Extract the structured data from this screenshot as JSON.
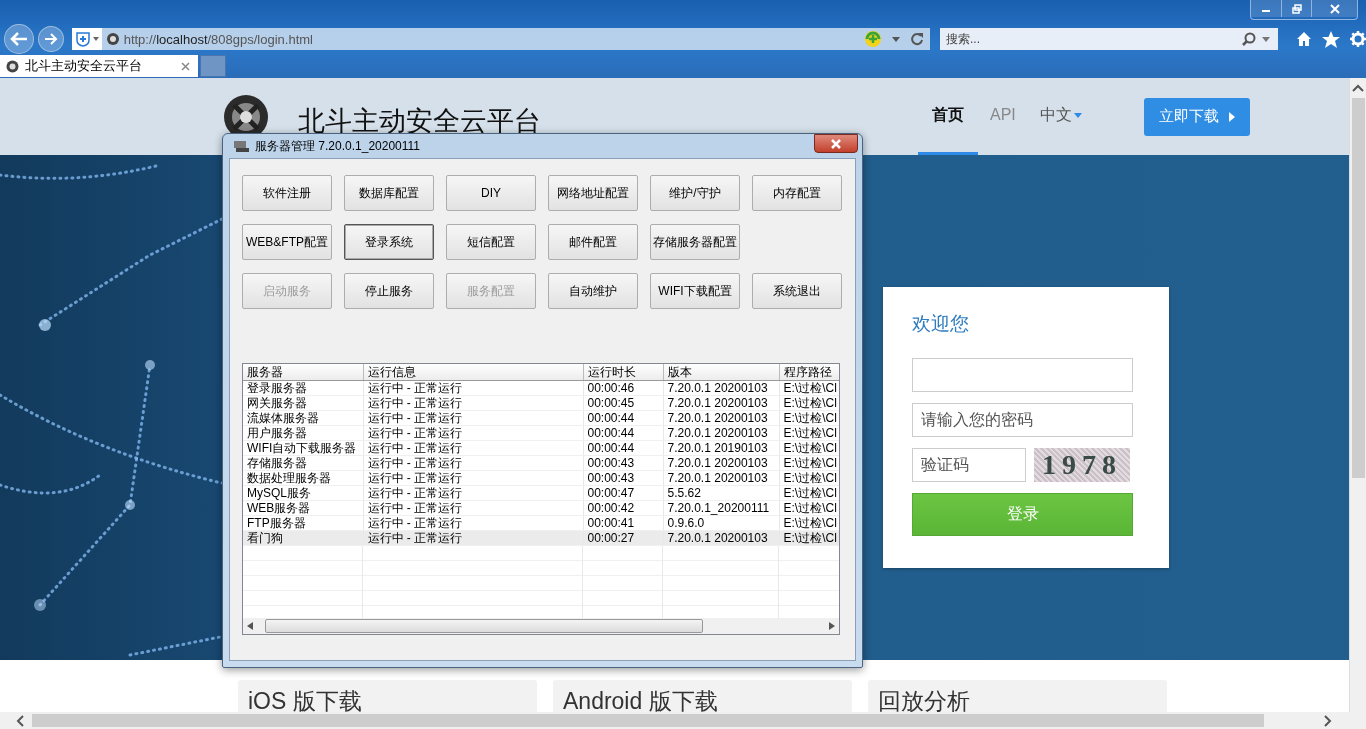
{
  "browser": {
    "address": "http://**localhost**/808gps/login.html",
    "search": {
      "placeholder": "搜索..."
    },
    "tabs": [
      {
        "title": "北斗主动安全云平台",
        "selected": true
      }
    ]
  },
  "site": {
    "title": "北斗主动安全云平台",
    "nav": [
      {
        "label": "首页",
        "selected": true,
        "kind": "link"
      },
      {
        "label": "API",
        "selected": false,
        "kind": "link"
      },
      {
        "label": "中文",
        "selected": false,
        "kind": "dropdown"
      }
    ],
    "download_button": "立即下载"
  },
  "login": {
    "heading": "欢迎您",
    "password": {
      "placeholder": "请输入您的密码"
    },
    "captcha": {
      "placeholder": "验证码",
      "code": "1978"
    },
    "submit": "登录"
  },
  "downloads": [
    {
      "title": "iOS 版下载"
    },
    {
      "title": "Android 版下载"
    },
    {
      "title": "回放分析"
    }
  ],
  "dialog": {
    "title": "服务器管理 7.20.0.1_20200111",
    "button_rows": [
      [
        {
          "label": "软件注册",
          "disabled": false,
          "default": false
        },
        {
          "label": "数据库配置",
          "disabled": false,
          "default": false
        },
        {
          "label": "DIY",
          "disabled": false,
          "default": false
        },
        {
          "label": "网络地址配置",
          "disabled": false,
          "default": false
        },
        {
          "label": "维护/守护",
          "disabled": false,
          "default": false
        },
        {
          "label": "内存配置",
          "disabled": false,
          "default": false
        }
      ],
      [
        {
          "label": "WEB&FTP配置",
          "disabled": false,
          "default": false
        },
        {
          "label": "登录系统",
          "disabled": false,
          "default": true
        },
        {
          "label": "短信配置",
          "disabled": false,
          "default": false
        },
        {
          "label": "邮件配置",
          "disabled": false,
          "default": false
        },
        {
          "label": "存储服务器配置",
          "disabled": false,
          "default": false
        }
      ],
      [
        {
          "label": "启动服务",
          "disabled": true,
          "default": false
        },
        {
          "label": "停止服务",
          "disabled": false,
          "default": false
        },
        {
          "label": "服务配置",
          "disabled": true,
          "default": false
        },
        {
          "label": "自动维护",
          "disabled": false,
          "default": false
        },
        {
          "label": "WIFI下载配置",
          "disabled": false,
          "default": false
        },
        {
          "label": "系统退出",
          "disabled": false,
          "default": false
        }
      ]
    ],
    "table": {
      "columns": [
        "服务器",
        "运行信息",
        "运行时长",
        "版本",
        "程序路径"
      ],
      "rows": [
        {
          "cells": [
            "登录服务器",
            "运行中 - 正常运行",
            "00:00:46",
            "7.20.0.1 20200103",
            "E:\\过检\\Cl"
          ],
          "selected": false
        },
        {
          "cells": [
            "网关服务器",
            "运行中 - 正常运行",
            "00:00:45",
            "7.20.0.1 20200103",
            "E:\\过检\\Cl"
          ],
          "selected": false
        },
        {
          "cells": [
            "流媒体服务器",
            "运行中 - 正常运行",
            "00:00:44",
            "7.20.0.1 20200103",
            "E:\\过检\\Cl"
          ],
          "selected": false
        },
        {
          "cells": [
            "用户服务器",
            "运行中 - 正常运行",
            "00:00:44",
            "7.20.0.1 20200103",
            "E:\\过检\\Cl"
          ],
          "selected": false
        },
        {
          "cells": [
            "WIFI自动下载服务器",
            "运行中 - 正常运行",
            "00:00:44",
            "7.20.0.1 20190103",
            "E:\\过检\\Cl"
          ],
          "selected": false
        },
        {
          "cells": [
            "存储服务器",
            "运行中 - 正常运行",
            "00:00:43",
            "7.20.0.1 20200103",
            "E:\\过检\\Cl"
          ],
          "selected": false
        },
        {
          "cells": [
            "数据处理服务器",
            "运行中 - 正常运行",
            "00:00:43",
            "7.20.0.1 20200103",
            "E:\\过检\\Cl"
          ],
          "selected": false
        },
        {
          "cells": [
            "MySQL服务",
            "运行中 - 正常运行",
            "00:00:47",
            "5.5.62",
            "E:\\过检\\Cl"
          ],
          "selected": false
        },
        {
          "cells": [
            "WEB服务器",
            "运行中 - 正常运行",
            "00:00:42",
            "7.20.0.1_20200111",
            "E:\\过检\\Cl"
          ],
          "selected": false
        },
        {
          "cells": [
            "FTP服务器",
            "运行中 - 正常运行",
            "00:00:41",
            "0.9.6.0",
            "E:\\过检\\Cl"
          ],
          "selected": false
        },
        {
          "cells": [
            "看门狗",
            "运行中 - 正常运行",
            "00:00:27",
            "7.20.0.1 20200103",
            "E:\\过检\\Cl"
          ],
          "selected": true
        }
      ]
    }
  }
}
